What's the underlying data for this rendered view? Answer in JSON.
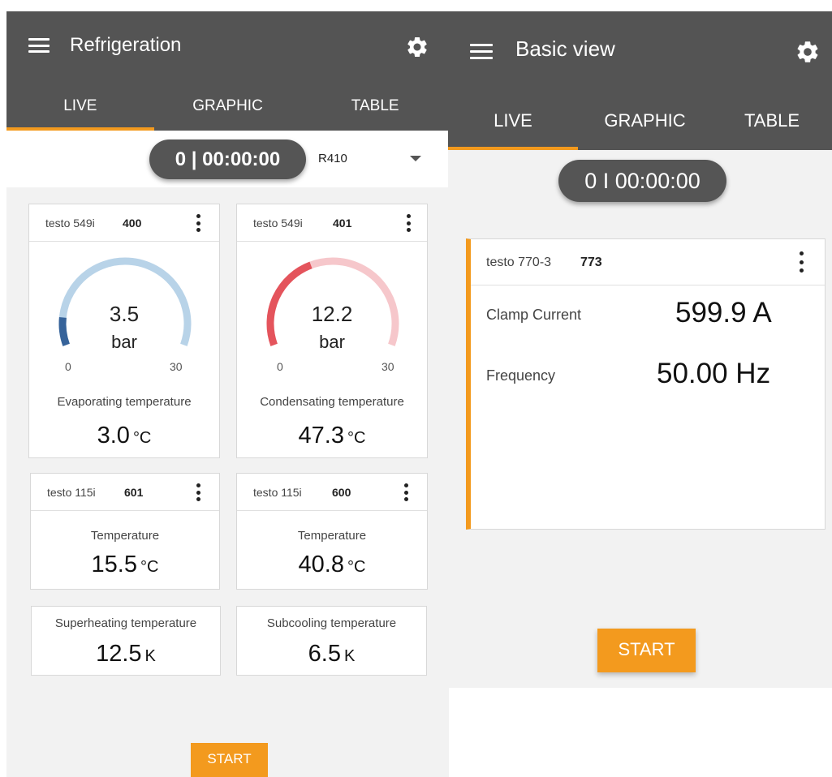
{
  "left": {
    "title": "Refrigeration",
    "tabs": [
      {
        "label": "LIVE",
        "active": true
      },
      {
        "label": "GRAPHIC",
        "active": false
      },
      {
        "label": "TABLE",
        "active": false
      }
    ],
    "timer": "0 | 00:00:00",
    "refrigerant": "R410",
    "gauge_cards": [
      {
        "probe_name": "testo 549i",
        "probe_id": "400",
        "value": "3.5",
        "value_num": 3.5,
        "unit": "bar",
        "min": "0",
        "max": "30",
        "min_num": 0,
        "max_num": 30,
        "label": "Evaporating temperature",
        "reading": "3.0",
        "reading_unit": "°C",
        "track_color": "#b8d3e8",
        "fill_color": "#36639a"
      },
      {
        "probe_name": "testo 549i",
        "probe_id": "401",
        "value": "12.2",
        "value_num": 12.2,
        "unit": "bar",
        "min": "0",
        "max": "30",
        "min_num": 0,
        "max_num": 30,
        "label": "Condensating temperature",
        "reading": "47.3",
        "reading_unit": "°C",
        "track_color": "#f6c7cb",
        "fill_color": "#e4545c"
      }
    ],
    "temp_cards": [
      {
        "probe_name": "testo 115i",
        "probe_id": "601",
        "label": "Temperature",
        "reading": "15.5",
        "reading_unit": "°C"
      },
      {
        "probe_name": "testo 115i",
        "probe_id": "600",
        "label": "Temperature",
        "reading": "40.8",
        "reading_unit": "°C"
      }
    ],
    "calc_cards": [
      {
        "label": "Superheating temperature",
        "reading": "12.5",
        "reading_unit": "K"
      },
      {
        "label": "Subcooling temperature",
        "reading": "6.5",
        "reading_unit": "K"
      }
    ],
    "start_label": "START"
  },
  "right": {
    "title": "Basic view",
    "tabs": [
      {
        "label": "LIVE",
        "active": true
      },
      {
        "label": "GRAPHIC",
        "active": false
      },
      {
        "label": "TABLE",
        "active": false
      }
    ],
    "timer": "0 I 00:00:00",
    "card": {
      "probe_name": "testo 770-3",
      "probe_id": "773",
      "rows": [
        {
          "label": "Clamp Current",
          "value": "599.9 A"
        },
        {
          "label": "Frequency",
          "value": "50.00 Hz"
        }
      ]
    },
    "start_label": "START"
  },
  "colors": {
    "header": "#545454",
    "accent": "#f39a1e",
    "background": "#f2f2f2"
  },
  "icons": [
    "menu-icon",
    "gear-icon",
    "dropdown-arrow-icon",
    "more-vert-icon"
  ]
}
